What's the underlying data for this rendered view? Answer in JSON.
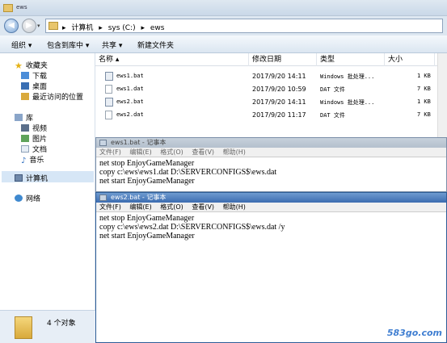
{
  "window": {
    "title": "ews"
  },
  "address": {
    "crumbs": [
      "▸",
      "计算机",
      "▸",
      "sys (C:)",
      "▸",
      "ews"
    ]
  },
  "toolbar": {
    "organize": "组织 ▾",
    "include_library": "包含到库中 ▾",
    "share": "共享 ▾",
    "new_folder": "新建文件夹"
  },
  "nav": {
    "favorites": "收藏夹",
    "downloads": "下载",
    "desktop": "桌面",
    "recent": "最近访问的位置",
    "libraries": "库",
    "videos": "视频",
    "pictures": "图片",
    "documents": "文档",
    "music": "音乐",
    "computer": "计算机",
    "network": "网络"
  },
  "details": {
    "count": "4 个对象"
  },
  "columns": {
    "name": "名称 ▴",
    "date": "修改日期",
    "type": "类型",
    "size": "大小"
  },
  "files": [
    {
      "name": "ews1.bat",
      "date": "2017/9/20 14:11",
      "type": "Windows 批处理...",
      "size": "1 KB",
      "icon": "bat"
    },
    {
      "name": "ews1.dat",
      "date": "2017/9/20 10:59",
      "type": "DAT 文件",
      "size": "7 KB",
      "icon": "dat"
    },
    {
      "name": "ews2.bat",
      "date": "2017/9/20 14:11",
      "type": "Windows 批处理...",
      "size": "1 KB",
      "icon": "bat"
    },
    {
      "name": "ews2.dat",
      "date": "2017/9/20 11:17",
      "type": "DAT 文件",
      "size": "7 KB",
      "icon": "dat"
    }
  ],
  "notepad1": {
    "title": "ews1.bat - 记事本",
    "menu": [
      "文件(F)",
      "编辑(E)",
      "格式(O)",
      "查看(V)",
      "帮助(H)"
    ],
    "lines": [
      "net stop EnjoyGameManager",
      "copy c:\\ews\\ews1.dat D:\\SERVERCONFIGS$\\ews.dat",
      "net start EnjoyGameManager"
    ]
  },
  "notepad2": {
    "title": "ews2.bat - 记事本",
    "menu": [
      "文件(F)",
      "编辑(E)",
      "格式(O)",
      "查看(V)",
      "帮助(H)"
    ],
    "lines": [
      "net stop EnjoyGameManager",
      "copy c:\\ews\\ews2.dat D:\\SERVERCONFIGS$\\ews.dat /y",
      "net start EnjoyGameManager"
    ]
  },
  "watermark": "583go.com"
}
